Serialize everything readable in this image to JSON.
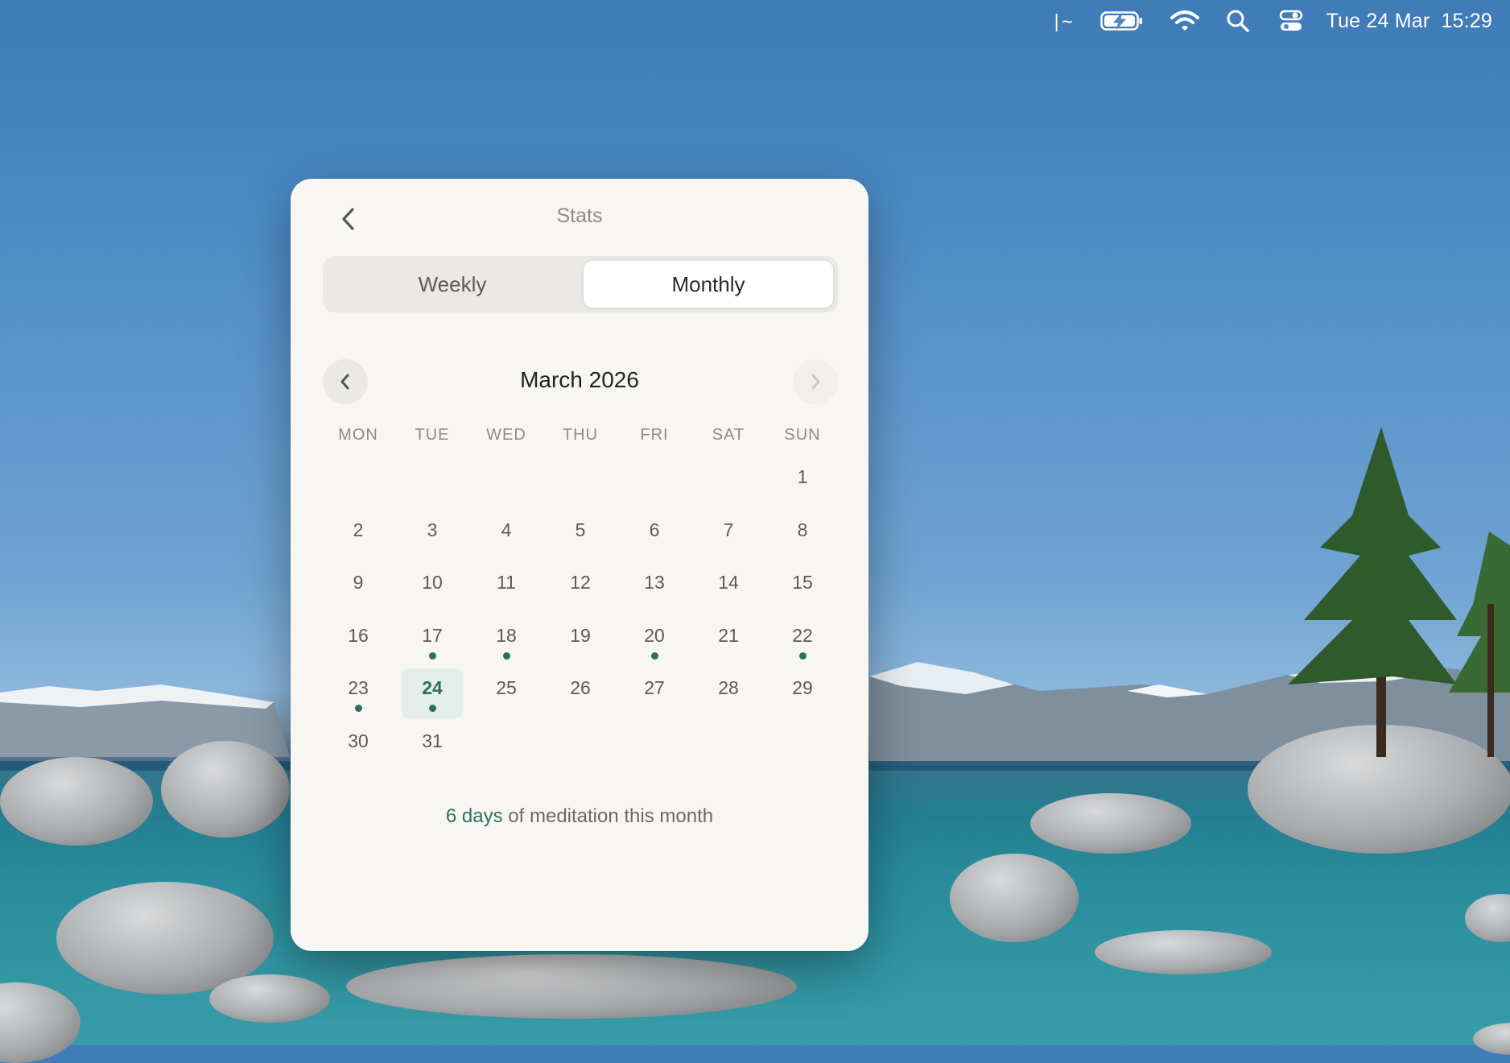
{
  "menubar": {
    "terminal_icon": "terminal-glyph-icon",
    "date": "Tue 24 Mar",
    "time": "15:29"
  },
  "window": {
    "title": "Stats",
    "tabs": [
      {
        "label": "Weekly",
        "active": false
      },
      {
        "label": "Monthly",
        "active": true
      }
    ],
    "month_label": "March 2026",
    "weekdays": [
      "MON",
      "TUE",
      "WED",
      "THU",
      "FRI",
      "SAT",
      "SUN"
    ],
    "leading_blanks": 6,
    "days": [
      {
        "n": "1"
      },
      {
        "n": "2"
      },
      {
        "n": "3"
      },
      {
        "n": "4"
      },
      {
        "n": "5"
      },
      {
        "n": "6"
      },
      {
        "n": "7"
      },
      {
        "n": "8"
      },
      {
        "n": "9"
      },
      {
        "n": "10"
      },
      {
        "n": "11"
      },
      {
        "n": "12"
      },
      {
        "n": "13"
      },
      {
        "n": "14"
      },
      {
        "n": "15"
      },
      {
        "n": "16"
      },
      {
        "n": "17",
        "dot": true
      },
      {
        "n": "18",
        "dot": true
      },
      {
        "n": "19"
      },
      {
        "n": "20",
        "dot": true
      },
      {
        "n": "21"
      },
      {
        "n": "22",
        "dot": true
      },
      {
        "n": "23",
        "dot": true
      },
      {
        "n": "24",
        "dot": true,
        "today": true
      },
      {
        "n": "25"
      },
      {
        "n": "26"
      },
      {
        "n": "27"
      },
      {
        "n": "28"
      },
      {
        "n": "29"
      },
      {
        "n": "30"
      },
      {
        "n": "31"
      }
    ],
    "summary_highlight": "6 days",
    "summary_rest": " of meditation this month",
    "accent_color": "#2d6f5e"
  }
}
